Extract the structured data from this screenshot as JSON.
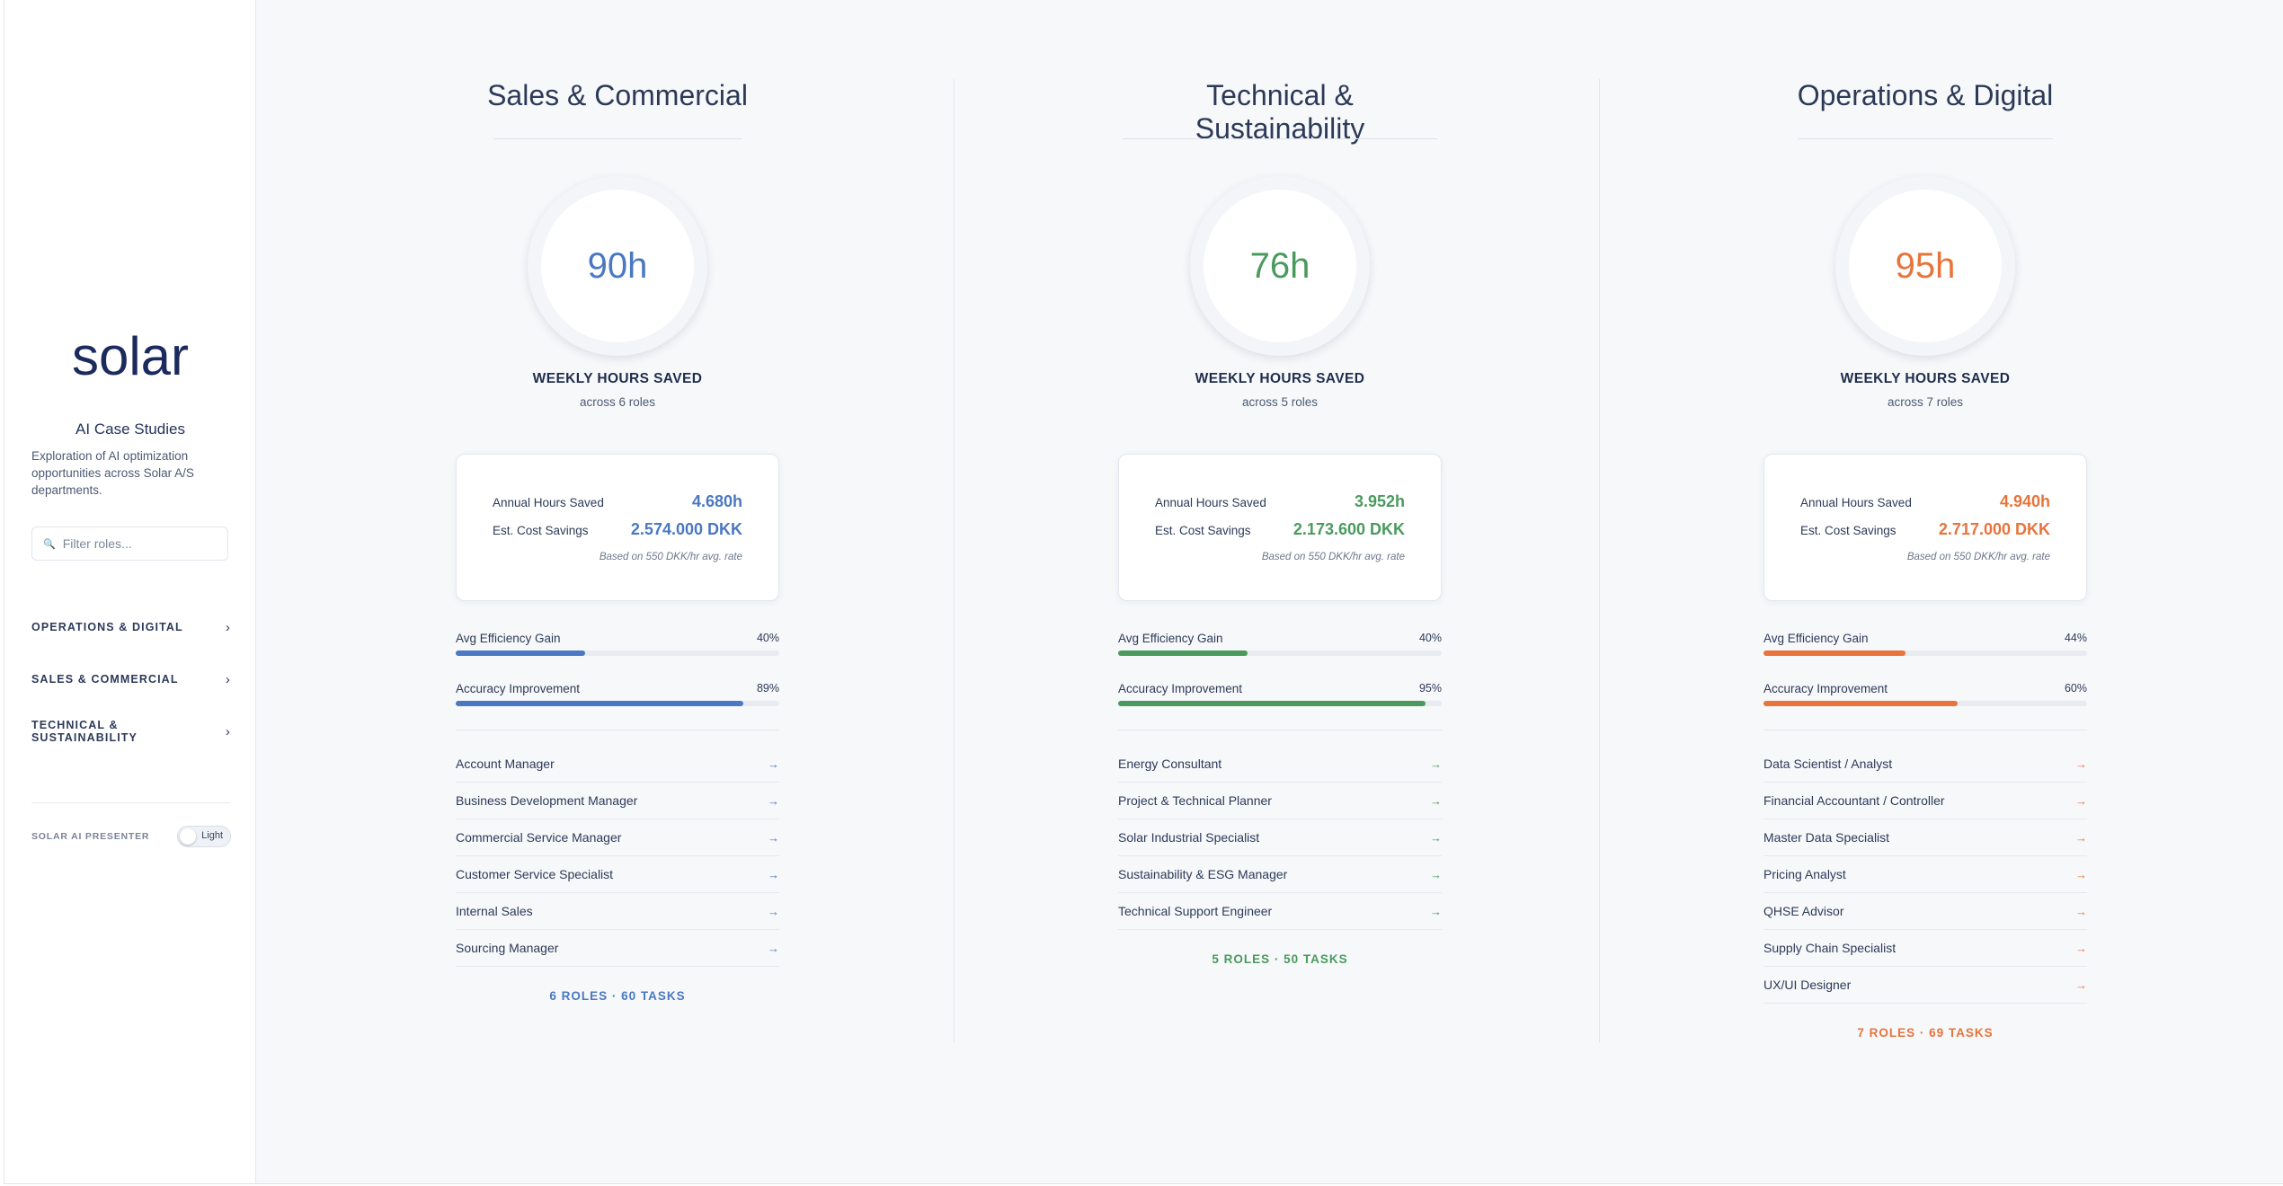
{
  "sidebar": {
    "logo": "solar",
    "subtitle": "AI Case Studies",
    "description": "Exploration of AI optimization opportunities across Solar A/S departments.",
    "filter_placeholder": "Filter roles...",
    "search_icon": "🔍",
    "nav": [
      {
        "label": "OPERATIONS & DIGITAL",
        "icon": "chevron-right"
      },
      {
        "label": "SALES & COMMERCIAL",
        "icon": "chevron-right"
      },
      {
        "label": "TECHNICAL & SUSTAINABILITY",
        "icon": "chevron-right"
      }
    ],
    "chevron": "›",
    "presenter_label": "SOLAR AI PRESENTER",
    "theme_toggle": "Light"
  },
  "common": {
    "weekly_label": "WEEKLY HOURS SAVED",
    "annual_label": "Annual Hours Saved",
    "cost_label": "Est. Cost Savings",
    "rate_note": "Based on 550 DKK/hr avg. rate",
    "efficiency_label": "Avg Efficiency Gain",
    "accuracy_label": "Accuracy Improvement",
    "arrow": "→"
  },
  "columns": [
    {
      "title": "Sales & Commercial",
      "color": "#4a78c2",
      "weekly_hours": "90h",
      "across": "across 6 roles",
      "annual_hours": "4.680h",
      "cost_savings": "2.574.000 DKK",
      "efficiency_pct": "40%",
      "efficiency_value": 0.4,
      "accuracy_pct": "89%",
      "accuracy_value": 0.89,
      "roles": [
        "Account Manager",
        "Business Development Manager",
        "Commercial Service Manager",
        "Customer Service Specialist",
        "Internal Sales",
        "Sourcing Manager"
      ],
      "summary": "6 ROLES · 60 TASKS"
    },
    {
      "title": "Technical & Sustainability",
      "color": "#4a9a5e",
      "weekly_hours": "76h",
      "across": "across 5 roles",
      "annual_hours": "3.952h",
      "cost_savings": "2.173.600 DKK",
      "efficiency_pct": "40%",
      "efficiency_value": 0.4,
      "accuracy_pct": "95%",
      "accuracy_value": 0.95,
      "roles": [
        "Energy Consultant",
        "Project & Technical Planner",
        "Solar Industrial Specialist",
        "Sustainability & ESG Manager",
        "Technical Support Engineer"
      ],
      "summary": "5 ROLES · 50 TASKS"
    },
    {
      "title": "Operations & Digital",
      "color": "#e8743b",
      "weekly_hours": "95h",
      "across": "across 7 roles",
      "annual_hours": "4.940h",
      "cost_savings": "2.717.000 DKK",
      "efficiency_pct": "44%",
      "efficiency_value": 0.44,
      "accuracy_pct": "60%",
      "accuracy_value": 0.6,
      "roles": [
        "Data Scientist / Analyst",
        "Financial Accountant / Controller",
        "Master Data Specialist",
        "Pricing Analyst",
        "QHSE Advisor",
        "Supply Chain Specialist",
        "UX/UI Designer"
      ],
      "summary": "7 ROLES · 69 TASKS"
    }
  ]
}
